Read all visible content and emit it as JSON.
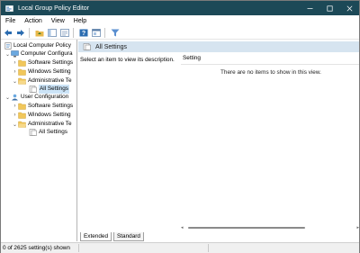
{
  "window": {
    "title": "Local Group Policy Editor",
    "icon": "group-policy-app-icon",
    "accent_color": "#1c4957"
  },
  "menu": [
    "File",
    "Action",
    "View",
    "Help"
  ],
  "toolbar": {
    "buttons": [
      "back-arrow-icon",
      "forward-arrow-icon",
      "folder-up-icon",
      "show-hide-tree-icon",
      "export-list-icon",
      "help-icon",
      "properties-icon",
      "filter-icon"
    ]
  },
  "tree": {
    "root": "Local Computer Policy",
    "computer_config": "Computer Configura",
    "software_settings_1": "Software Settings",
    "windows_settings_1": "Windows Setting",
    "admin_templates_1": "Administrative Te",
    "all_settings_1": "All Settings",
    "user_config": "User Configuration",
    "software_settings_2": "Software Settings",
    "windows_settings_2": "Windows Setting",
    "admin_templates_2": "Administrative Te",
    "all_settings_2": "All Settings"
  },
  "right_pane": {
    "header_title": "All Settings",
    "description": "Select an item to view its description.",
    "column_setting": "Setting",
    "empty_message": "There are no items to show in this view."
  },
  "tabs": [
    "Extended",
    "Standard"
  ],
  "status": "0 of 2625 setting(s) shown"
}
